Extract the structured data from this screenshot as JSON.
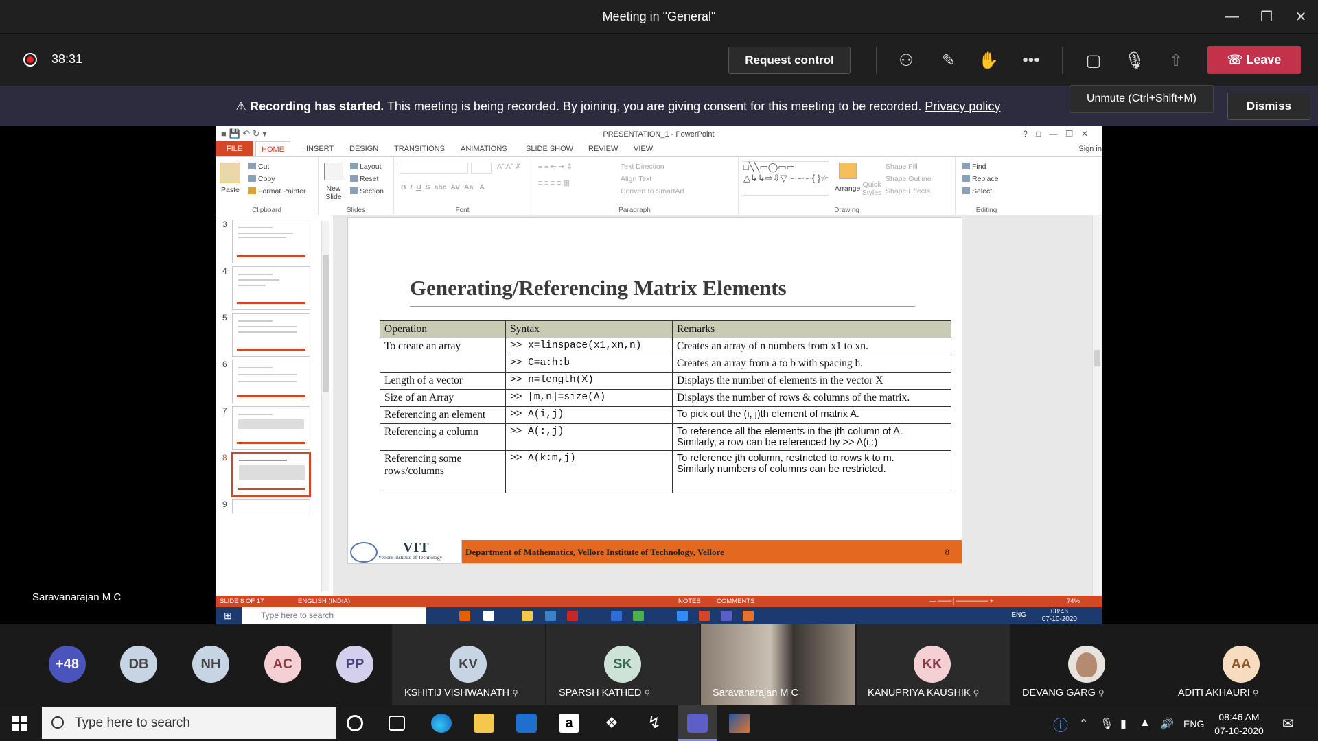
{
  "window": {
    "title": "Meeting in \"General\""
  },
  "meeting": {
    "timer": "38:31",
    "request_control": "Request control",
    "leave": "Leave",
    "tooltip": "Unmute (Ctrl+Shift+M)",
    "banner_bold": "Recording has started.",
    "banner_text": "This meeting is being recorded. By joining, you are giving consent for this meeting to be recorded.",
    "banner_link": "Privacy policy",
    "dismiss": "Dismiss",
    "presenter": "Saravanarajan M C"
  },
  "ppt": {
    "title": "PRESENTATION_1 - PowerPoint",
    "signin": "Sign in",
    "tabs": [
      "FILE",
      "HOME",
      "INSERT",
      "DESIGN",
      "TRANSITIONS",
      "ANIMATIONS",
      "SLIDE SHOW",
      "REVIEW",
      "VIEW"
    ],
    "clipboard": {
      "paste": "Paste",
      "cut": "Cut",
      "copy": "Copy",
      "format_painter": "Format Painter",
      "label": "Clipboard"
    },
    "slides_group": {
      "new_slide": "New Slide",
      "layout": "Layout",
      "reset": "Reset",
      "section": "Section",
      "label": "Slides"
    },
    "font_label": "Font",
    "paragraph": {
      "text_direction": "Text Direction",
      "align_text": "Align Text",
      "convert": "Convert to SmartArt",
      "label": "Paragraph"
    },
    "drawing": {
      "arrange": "Arrange",
      "quick_styles": "Quick Styles",
      "shape_fill": "Shape Fill",
      "shape_outline": "Shape Outline",
      "shape_effects": "Shape Effects",
      "label": "Drawing"
    },
    "editing": {
      "find": "Find",
      "replace": "Replace",
      "select": "Select",
      "label": "Editing"
    },
    "thumb_numbers": [
      "3",
      "4",
      "5",
      "6",
      "7",
      "8",
      "9"
    ],
    "slide": {
      "title": "Generating/Referencing Matrix Elements",
      "headers": [
        "Operation",
        "Syntax",
        "Remarks"
      ],
      "rows": [
        {
          "op": "To create an array",
          "syntax": ">>  x=linspace(x1,xn,n)",
          "remark": "Creates an array of n numbers from x1 to xn."
        },
        {
          "op": "",
          "syntax": ">>  C=a:h:b",
          "remark": "Creates an array from a to b with spacing h."
        },
        {
          "op": "Length of a vector",
          "syntax": ">>  n=length(X)",
          "remark": "Displays the number of elements in the vector X"
        },
        {
          "op": "Size of an Array",
          "syntax": ">>  [m,n]=size(A)",
          "remark": "Displays the number of rows & columns of the matrix."
        },
        {
          "op": "Referencing an element",
          "syntax": ">>  A(i,j)",
          "remark": "To pick out the  (i, j)th element of matrix A."
        },
        {
          "op": "Referencing a column",
          "syntax": ">>  A(:,j)",
          "remark": "To reference all the elements in the jth column of A.",
          "remark2": "Similarly, a row can be referenced by >>  A(i,:)"
        },
        {
          "op": "Referencing some rows/columns",
          "syntax": ">>  A(k:m,j)",
          "remark": "To reference jth column, restricted to rows k to m.",
          "remark2": "Similarly numbers of columns can be restricted."
        }
      ],
      "footer": "Department of Mathematics, Vellore Institute of Technology, Vellore",
      "page": "8",
      "logo_text": "VIT",
      "logo_sub": "Vellore Institute of Technology"
    },
    "status": {
      "slide": "SLIDE 8 OF 17",
      "lang": "ENGLISH (INDIA)",
      "notes": "NOTES",
      "comments": "COMMENTS",
      "zoom": "74%"
    },
    "inner_taskbar": {
      "search": "Type here to search",
      "lang": "ENG",
      "time": "08:46",
      "date": "07-10-2020"
    }
  },
  "participants": [
    {
      "initials": "+48",
      "color": "#4b53bc",
      "name": ""
    },
    {
      "initials": "DB",
      "color": "#c7d4e4",
      "name": ""
    },
    {
      "initials": "NH",
      "color": "#c7d4e4",
      "name": ""
    },
    {
      "initials": "AC",
      "color": "#f4d0d4",
      "name": ""
    },
    {
      "initials": "PP",
      "color": "#d4d0ec",
      "name": ""
    },
    {
      "initials": "KV",
      "color": "#c7d4e4",
      "name": "KSHITIJ VISHWANATH"
    },
    {
      "initials": "SK",
      "color": "#cde3d8",
      "name": "SPARSH KATHED"
    },
    {
      "initials": "",
      "color": "#6b6058",
      "name": "Saravanarajan M C"
    },
    {
      "initials": "KK",
      "color": "#f4d0d4",
      "name": "KANUPRIYA KAUSHIK"
    },
    {
      "initials": "",
      "color": "#ffffff",
      "name": "DEVANG GARG"
    },
    {
      "initials": "AA",
      "color": "#f7dcc0",
      "name": "ADITI AKHAURI"
    }
  ],
  "taskbar": {
    "search": "Type here to search",
    "lang": "ENG",
    "time": "08:46 AM",
    "date": "07-10-2020"
  }
}
